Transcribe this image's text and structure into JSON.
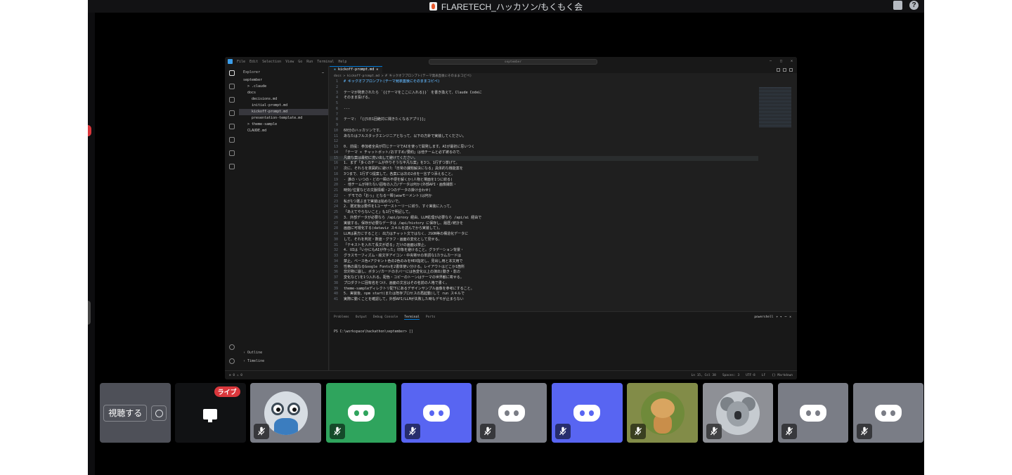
{
  "window": {
    "title": "FLARETECH_ハッカソン/もくもく会"
  },
  "vscode": {
    "menu": [
      "File",
      "Edit",
      "Selection",
      "View",
      "Go",
      "Run",
      "Terminal",
      "Help"
    ],
    "command_center": "september",
    "sidebar": {
      "title": "Explorer",
      "tree": [
        {
          "label": "september",
          "indent": 0
        },
        {
          "label": "> .claude",
          "indent": 1
        },
        {
          "label": "docs",
          "indent": 1
        },
        {
          "label": "decisions.md",
          "indent": 2
        },
        {
          "label": "initial-prompt.md",
          "indent": 2
        },
        {
          "label": "kickoff-prompt.md",
          "indent": 2,
          "selected": true
        },
        {
          "label": "presentation-template.md",
          "indent": 2
        },
        {
          "label": "> theme-sample",
          "indent": 1
        },
        {
          "label": "CLAUDE.md",
          "indent": 1
        }
      ],
      "outline": "Outline",
      "timeline": "Timeline"
    },
    "tab": "kickoff-prompt.md",
    "breadcrumb": "docs > kickoff-prompt.md > # キックオフプロンプト(テーマ発表直後にそのままコピペ)",
    "code": [
      "# キックオフプロンプト(テーマ発表直後にそのままコピペ)",
      "",
      "テーマが発表されたら `{{テーマをここに入れる}}` を書き換えて、Claude Codeに",
      "そのまま投げる。",
      "",
      "---",
      "",
      "テーマ: 「{{5日1回絶対に聞きたくなるアプリ}}」",
      "",
      "60分のハッカソンです。",
      "あなたはフルスタックエンジニアとなって、以下の方針で実装してください。",
      "",
      "0. 前提: 参加者全員が同じテーマでAIを使って開発します。AIが最初に思いつく",
      "   「テーマ × チャットボット/おすすめ/要約」は他チームと必ず被るので、",
      "   凡庸な案は最初に洗い出して避けてください。",
      "1. まず「多くのチームが作りそうな平凡な案」を3つ、1行ずつ挙げて。",
      "   次に、それらを意図的に避けた「日常の課題解決になる」具体的な機能案を",
      "   3つまで、1行ずつ提案して。各案には次の2点を一言ずつ添えること。",
      "   - 誰の・いつの・どの一瞬の不便を解くか(人物と場面を1つに絞る)",
      "   - 他チームが持たない固有の入力/データは何か(外部API・画像撮影・",
      "     時刻/位置などの文脈情報・2つのデータの掛け合わせ)",
      "   - デモでの「おっ」となる一瞬(wowモーメント)は何か",
      "   私が1つ選ぶまで実装は始めないで。",
      "2. 選定後は要件を1ユーザーストーリーに絞り、すぐ実装に入って。",
      "   「あえてやらないこと」も1行で明記して。",
      "3. 外部データが必要なら /api/proxy 経由、LLM処理が必要なら /api/ai 経由で",
      "   実装する。保存が必要なデータは /api/history に保存し、履歴/統計を",
      "   画面に可視化する(dataviz スキルを読んでから実装して)。",
      "   LLMは裏方にすること: 出力はチャット文ではなく、JSON等の構造化データに",
      "   して、それを判定・数値・グラフ・画面の変化として見せる。",
      "   「テキストを入れて長文が返る」だけの画面は禁止。",
      "4. UIは「いかにもAIが作った」印象を避けること。グラデーション背景・",
      "   グラスモーフィズム・絵文字アイコン・中央寄せの単調な1カラムカードは",
      "   禁止。ベース色+アクセント色の2色のみをHEX指定し、見出し用と本文用で",
      "   性格の異なるGoogle Fontsを2書体使い分ける。レイアウトはどこか1箇所",
      "   非対称に崩し、ボタン/カードのホバーには色変化以上の演出(動き・影の",
      "   変化など)を1つ入れる。配色・コピーのトーンはテーマの世界観に寄せる。",
      "   プロダクトに固有名をつけ、画面の文言はその名前の人格で書く。",
      "   theme-sampleディレクトリ配下にあるデザインサンプル画像を参考にすること。",
      "5. 実装後、npm start(または既存プロセスの再起動)して run スキルで",
      "   実際に動くことを確認して。外部API/LLMが失敗した時もデモが止まらない"
    ],
    "highlight_line": 15,
    "panel": {
      "tabs": [
        "Problems",
        "Output",
        "Debug Console",
        "Terminal",
        "Ports"
      ],
      "active_tab": "Terminal",
      "shell": "powershell",
      "prompt": "PS C:\\workspace\\hackathon\\september> []"
    },
    "status": {
      "left": "⊗ 0 ⚠ 0",
      "right": [
        "Ln 15, Col 38",
        "Spaces: 3",
        "UTF-8",
        "LF",
        "{} Markdown"
      ]
    }
  },
  "tiles": {
    "watch_label": "視聴する",
    "live_label": "ライブ",
    "participants": [
      {
        "kind": "owl",
        "bg": "#7a7d86",
        "muted": true
      },
      {
        "kind": "discord",
        "bg": "#2fa45d",
        "muted": true
      },
      {
        "kind": "discord",
        "bg": "#5865f2",
        "muted": true
      },
      {
        "kind": "discord",
        "bg": "#7a7d86",
        "muted": true
      },
      {
        "kind": "discord",
        "bg": "#5865f2",
        "muted": true
      },
      {
        "kind": "dog",
        "bg": "#828c48",
        "muted": true
      },
      {
        "kind": "koala",
        "bg": "#8e9096",
        "muted": true
      },
      {
        "kind": "discord",
        "bg": "#7a7d86",
        "muted": true
      },
      {
        "kind": "discord",
        "bg": "#7a7d86",
        "muted": true
      }
    ]
  }
}
